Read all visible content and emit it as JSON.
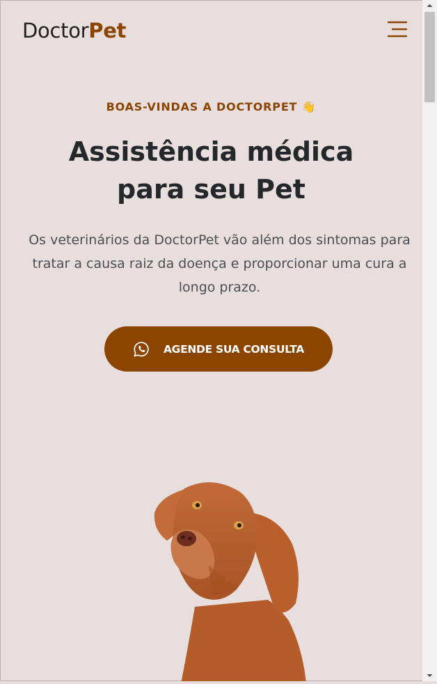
{
  "header": {
    "logo_part1": "Doctor",
    "logo_part2": "Pet",
    "menu_icon": "hamburger-menu-icon"
  },
  "hero": {
    "eyebrow": "BOAS-VINDAS A DOCTORPET 👋",
    "title_line1": "Assistência médica",
    "title_line2": "para seu Pet",
    "description": "Os veterinários da DoctorPet vão além dos sintomas para tratar a causa raiz da doença e proporcionar uma cura a longo prazo.",
    "cta_label": "AGENDE SUA CONSULTA",
    "cta_icon": "whatsapp-icon"
  },
  "colors": {
    "background": "#e9dede",
    "brand": "#8b4500",
    "text_dark": "#25282b",
    "text_muted": "#4a4d52"
  }
}
